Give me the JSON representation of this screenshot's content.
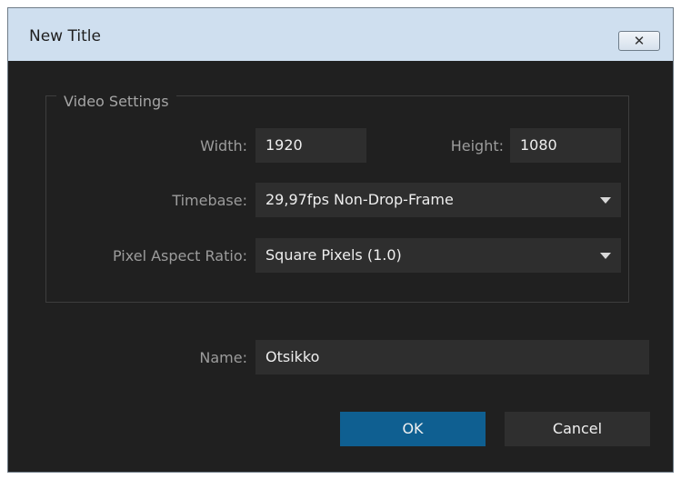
{
  "window": {
    "title": "New Title",
    "close_glyph": "✕"
  },
  "video_settings": {
    "group_title": "Video Settings",
    "width_label": "Width:",
    "width_value": "1920",
    "height_label": "Height:",
    "height_value": "1080",
    "timebase_label": "Timebase:",
    "timebase_value": "29,97fps Non-Drop-Frame",
    "par_label": "Pixel Aspect Ratio:",
    "par_value": "Square Pixels (1.0)"
  },
  "name_row": {
    "label": "Name:",
    "value": "Otsikko"
  },
  "buttons": {
    "ok": "OK",
    "cancel": "Cancel"
  },
  "icons": {
    "close": "close-icon",
    "dropdown": "chevron-down-icon"
  },
  "colors": {
    "dialog_bg": "#202020",
    "field_bg": "#2e2e2e",
    "accent": "#0f5f91",
    "titlebar": "#cfdfef"
  }
}
